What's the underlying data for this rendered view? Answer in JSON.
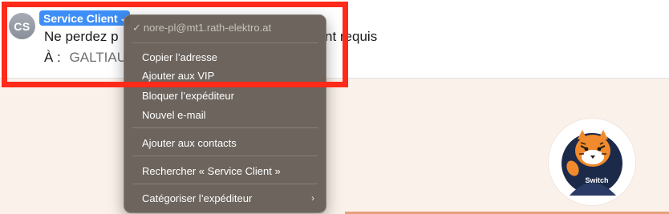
{
  "header": {
    "avatar_initials": "CS",
    "sender_name": "Service Client",
    "subject_start": "Ne perdez p",
    "subject_end": "nt requis",
    "to_label": "À :",
    "to_value": "GALTIAU"
  },
  "context_menu": {
    "email": "nore-pl@mt1.rath-elektro.at",
    "items": [
      "Copier l’adresse",
      "Ajouter aux VIP",
      "Bloquer l’expéditeur",
      "Nouvel e-mail",
      "Ajouter aux contacts",
      "Rechercher « Service Client »",
      "Catégoriser l’expéditeur"
    ]
  },
  "content": {
    "mascot_badge": "Switch"
  },
  "colors": {
    "sender_chip": "#3d8ef7",
    "highlight_box": "#ff2a1a",
    "menu_bg": "#675f58",
    "content_bg": "#faf1ea",
    "accent_rule": "#e6a07c"
  }
}
